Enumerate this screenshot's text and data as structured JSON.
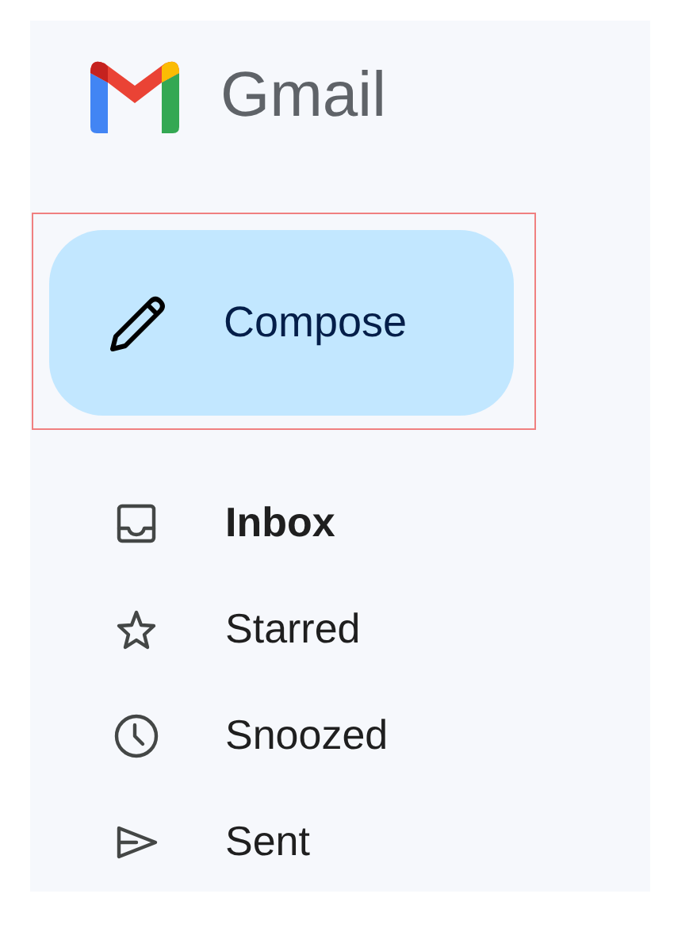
{
  "app": {
    "name": "Gmail"
  },
  "compose": {
    "label": "Compose",
    "highlighted": true
  },
  "nav": [
    {
      "label": "Inbox",
      "selected": true
    },
    {
      "label": "Starred",
      "selected": false
    },
    {
      "label": "Snoozed",
      "selected": false
    },
    {
      "label": "Sent",
      "selected": false
    }
  ]
}
